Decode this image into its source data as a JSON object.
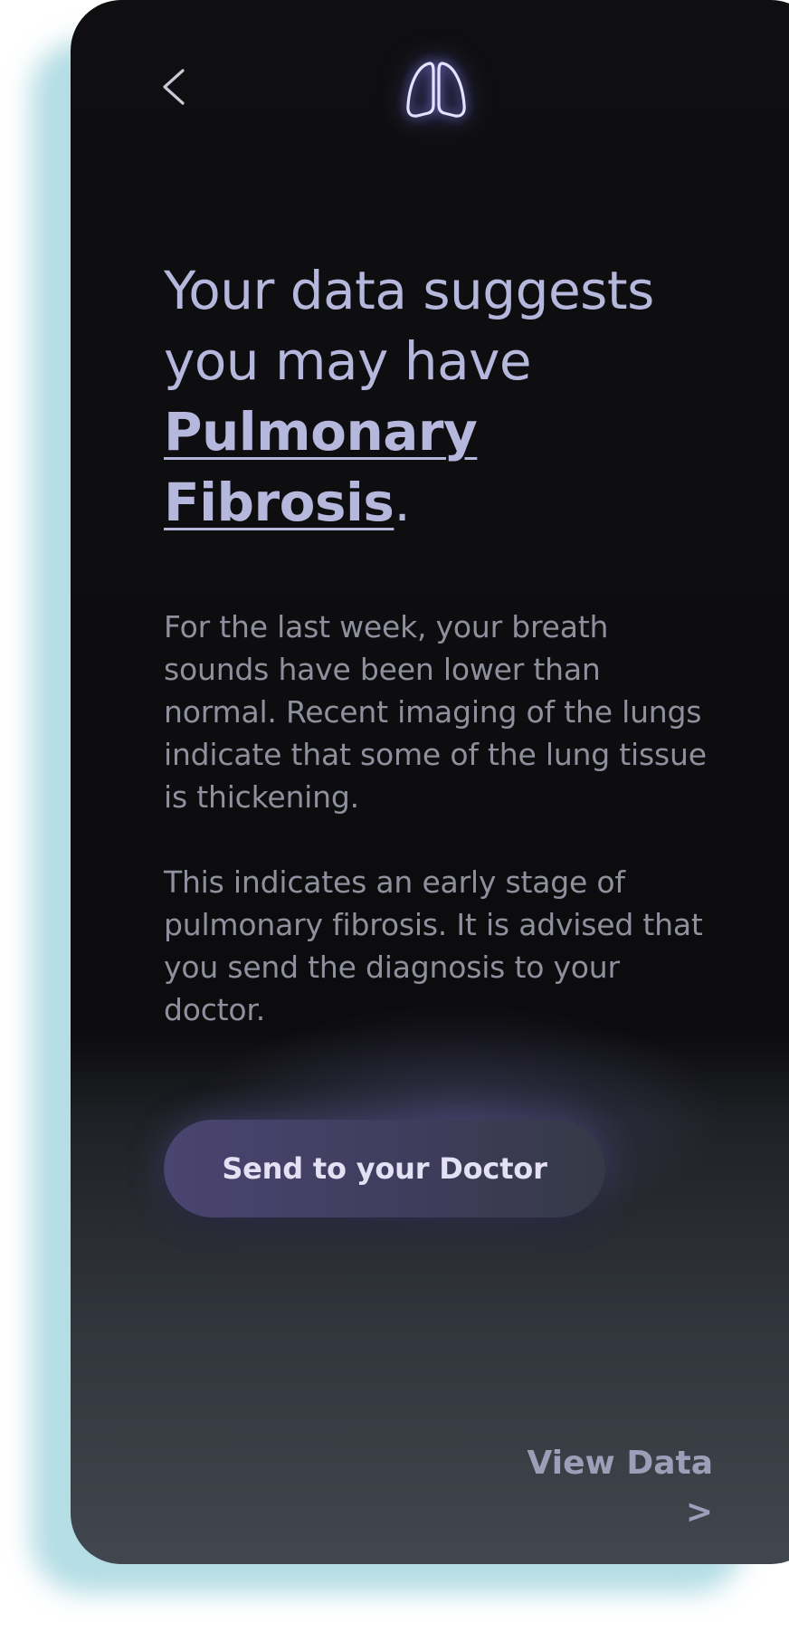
{
  "nav": {
    "back_icon": "chevron-left-icon",
    "logo_icon": "lungs-icon"
  },
  "headline": {
    "lead": "Your data suggests you may have ",
    "diagnosis": "Pulmonary Fibrosis",
    "end": "."
  },
  "body": {
    "paragraph_1": "For the last week, your breath sounds have been lower than normal. Recent imaging of the lungs indicate that some of the lung tissue is thickening.",
    "paragraph_2": "This indicates an early stage of pulmonary fibrosis. It is advised that you send the diagnosis to your doctor."
  },
  "actions": {
    "send_label": "Send to your Doctor",
    "view_data_label": "View Data >"
  },
  "colors": {
    "headline": "#b6b7dc",
    "body_text": "#8f909e",
    "accent_glow": "#8c84ff",
    "button_fill": "#45405f",
    "shadow": "#b4dde5"
  }
}
